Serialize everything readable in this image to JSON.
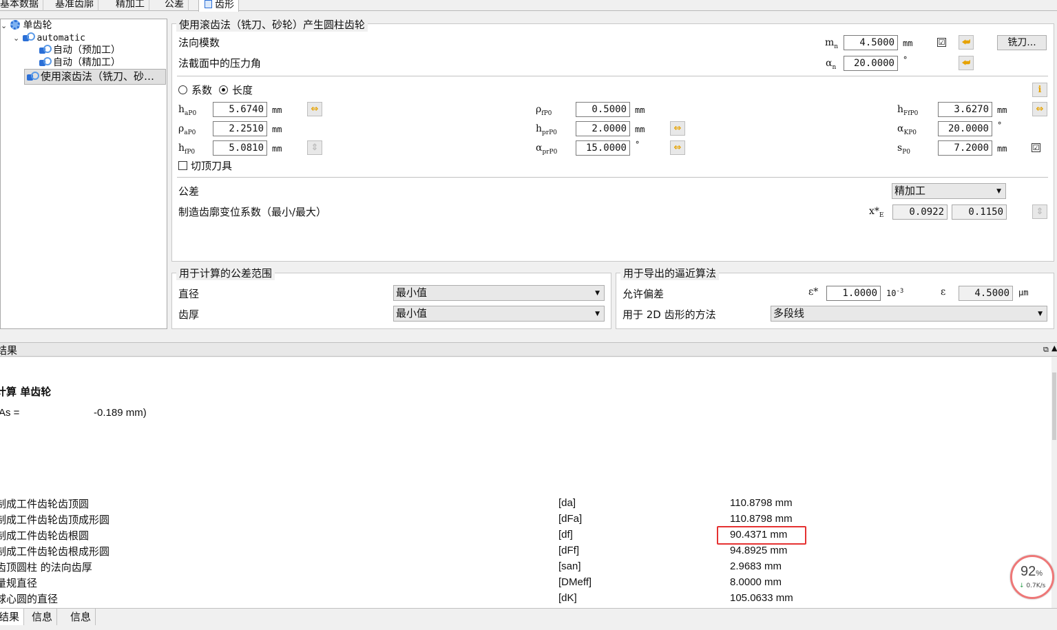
{
  "top_tabs": [
    "基本数据",
    "基准齿廓",
    "精加工",
    "公差",
    "齿形"
  ],
  "tree": {
    "root": "单齿轮",
    "automatic": "automatic",
    "child1": "自动（预加工）",
    "child2": "自动（精加工）",
    "child3": "使用滚齿法（铣刀、砂…"
  },
  "main": {
    "title": "使用滚齿法（铣刀、砂轮）产生圆柱齿轮",
    "normal_module_label": "法向模数",
    "mn_sym": "m",
    "mn_sub": "n",
    "mn_value": "4.5000",
    "mn_unit": "mm",
    "mn_checked": "☑",
    "cutter_button": "铣刀...",
    "pressure_angle_label": "法截面中的压力角",
    "an_sym": "α",
    "an_sub": "n",
    "an_value": "20.0000",
    "deg": "°",
    "radio_coef": "系数",
    "radio_length": "长度",
    "info_icon": "i",
    "params": {
      "haP0": {
        "sym": "h",
        "sub": "aP0",
        "value": "5.6740",
        "unit": "mm"
      },
      "rhoaP0": {
        "sym": "ρ",
        "sub": "aP0",
        "value": "2.2510",
        "unit": "mm"
      },
      "hfP0": {
        "sym": "h",
        "sub": "fP0",
        "value": "5.0810",
        "unit": "mm"
      },
      "rhofP0": {
        "sym": "ρ",
        "sub": "fP0",
        "value": "0.5000",
        "unit": "mm"
      },
      "hprP0": {
        "sym": "h",
        "sub": "prP0",
        "value": "2.0000",
        "unit": "mm"
      },
      "aprP0": {
        "sym": "α",
        "sub": "prP0",
        "value": "15.0000",
        "unit": "°"
      },
      "hFfP0": {
        "sym": "h",
        "sub": "FfP0",
        "value": "3.6270",
        "unit": "mm"
      },
      "aKP0": {
        "sym": "α",
        "sub": "KP0",
        "value": "20.0000",
        "unit": "°"
      },
      "sP0": {
        "sym": "s",
        "sub": "P0",
        "value": "7.2000",
        "unit": "mm"
      }
    },
    "tip_cutter_label": "切顶刀具",
    "tolerance_label": "公差",
    "tolerance_value": "精加工",
    "profile_shift_label": "制造齿廓变位系数（最小/最大）",
    "xE_sym": "x*",
    "xE_sub": "E",
    "xE_min": "0.0922",
    "xE_max": "0.1150"
  },
  "tolerance_range": {
    "title": "用于计算的公差范围",
    "diameter_label": "直径",
    "diameter_value": "最小值",
    "thickness_label": "齿厚",
    "thickness_value": "最小值"
  },
  "approx": {
    "title": "用于导出的逼近算法",
    "deviation_label": "允许偏差",
    "eps_star_sym": "ε*",
    "eps_star_value": "1.0000",
    "eps_star_unit": "10",
    "eps_star_exp": "-3",
    "eps_sym": "ε",
    "eps_value": "4.5000",
    "eps_unit": "µm",
    "method_label": "用于 2D 齿形的方法",
    "method_value": "多段线"
  },
  "results": {
    "header": "结果",
    "calc_title": "计算 单齿轮",
    "as_label": "As =",
    "as_value": "-0.189 mm)",
    "rows": [
      {
        "label": "制成工件齿轮齿顶圆",
        "sym": "[da]",
        "value": "110.8798 mm"
      },
      {
        "label": "制成工件齿轮齿顶成形圆",
        "sym": "[dFa]",
        "value": "110.8798 mm"
      },
      {
        "label": "制成工件齿轮齿根圆",
        "sym": "[df]",
        "value": "90.4371 mm"
      },
      {
        "label": "制成工件齿轮齿根成形圆",
        "sym": "[dFf]",
        "value": "94.8925 mm"
      },
      {
        "label": "齿顶圆柱 的法向齿厚",
        "sym": "[san]",
        "value": "2.9683 mm"
      },
      {
        "label": "量规直径",
        "sym": "[DMeff]",
        "value": "8.0000 mm"
      },
      {
        "label": "球心圆的直径",
        "sym": "[dK]",
        "value": "105.0633 mm"
      }
    ]
  },
  "bottom_tabs": [
    "结果",
    "信息",
    "信息"
  ],
  "speed": {
    "percent": "92",
    "pct_sign": "%",
    "rate": "0.7K/s"
  }
}
